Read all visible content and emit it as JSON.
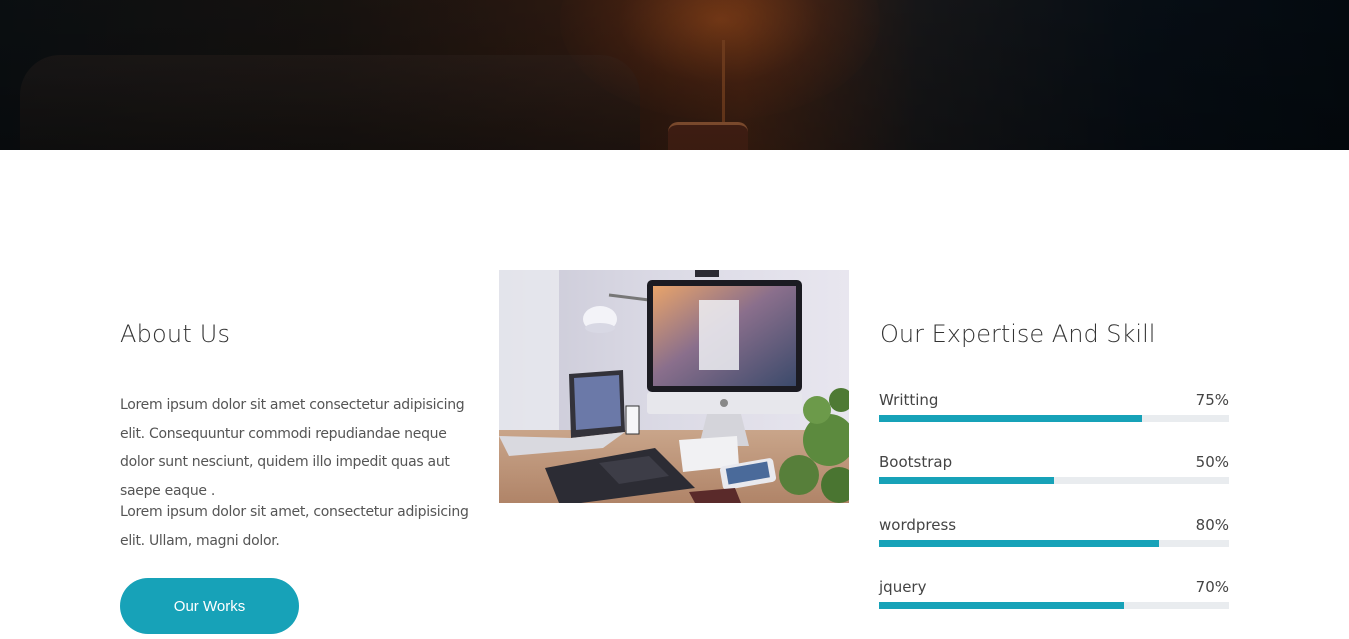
{
  "hero": {
    "icon": "hero-background-image"
  },
  "about": {
    "title": "About Us",
    "paragraph1": "Lorem ipsum dolor sit amet consectetur adipisicing elit. Consequuntur commodi repudiandae neque dolor sunt nesciunt, quidem illo impedit quas aut saepe eaque .",
    "paragraph2": "Lorem ipsum dolor sit amet, consectetur adipisicing elit. Ullam, magni dolor.",
    "button_label": "Our Works"
  },
  "image": {
    "icon": "workspace-desk-photo"
  },
  "expertise": {
    "title": "Our Expertise And Skill",
    "skills": [
      {
        "name": "Writting",
        "percent_label": "75%",
        "value": 0.75
      },
      {
        "name": "Bootstrap",
        "percent_label": "50%",
        "value": 0.5
      },
      {
        "name": "wordpress",
        "percent_label": "80%",
        "value": 0.8
      },
      {
        "name": "jquery",
        "percent_label": "70%",
        "value": 0.7
      }
    ]
  },
  "colors": {
    "accent": "#17a2b8",
    "track": "#e9ecef",
    "text": "#555555"
  }
}
